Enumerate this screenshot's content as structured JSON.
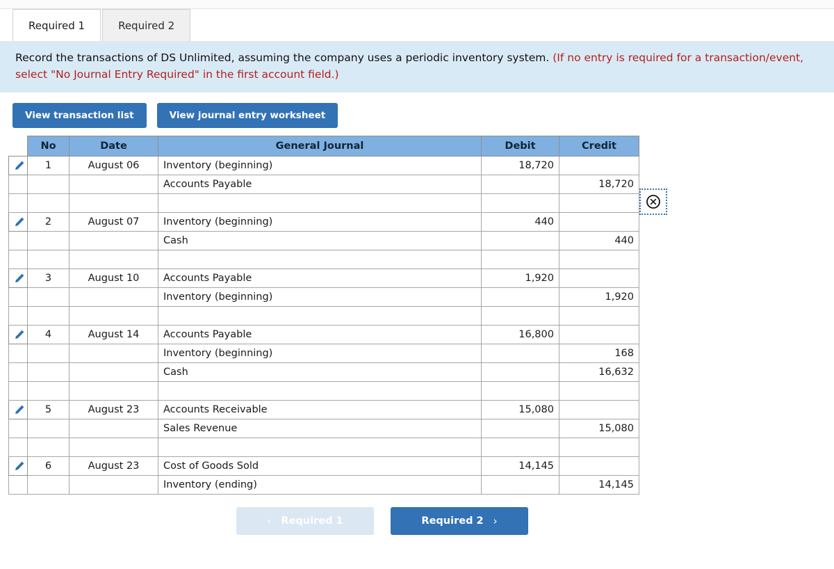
{
  "tabs": [
    {
      "label": "Required 1",
      "active": true
    },
    {
      "label": "Required 2",
      "active": false
    }
  ],
  "banner": {
    "text_black": "Record the transactions of DS Unlimited, assuming the company uses a periodic inventory system. ",
    "text_red": "(If no entry is required for a transaction/event, select \"No Journal Entry Required\" in the first account field.)"
  },
  "actions": {
    "view_transaction_list": "View transaction list",
    "view_journal_entry_worksheet": "View journal entry worksheet",
    "close_icon": "circle-x-icon"
  },
  "table": {
    "headers": {
      "no": "No",
      "date": "Date",
      "general_journal": "General Journal",
      "debit": "Debit",
      "credit": "Credit"
    },
    "rows": [
      {
        "kind": "entry",
        "pencil": "pencil-icon",
        "no": "1",
        "date": "August 06",
        "account": "Inventory (beginning)",
        "indent": false,
        "debit": "18,720",
        "credit": ""
      },
      {
        "kind": "line",
        "pencil": "",
        "no": "",
        "date": "",
        "account": "Accounts Payable",
        "indent": true,
        "debit": "",
        "credit": "18,720"
      },
      {
        "kind": "spacer",
        "pencil": "",
        "no": "",
        "date": "",
        "account": "",
        "indent": false,
        "debit": "",
        "credit": ""
      },
      {
        "kind": "entry",
        "pencil": "pencil-icon",
        "no": "2",
        "date": "August 07",
        "account": "Inventory (beginning)",
        "indent": false,
        "debit": "440",
        "credit": ""
      },
      {
        "kind": "line",
        "pencil": "",
        "no": "",
        "date": "",
        "account": "Cash",
        "indent": true,
        "debit": "",
        "credit": "440"
      },
      {
        "kind": "spacer",
        "pencil": "",
        "no": "",
        "date": "",
        "account": "",
        "indent": false,
        "debit": "",
        "credit": ""
      },
      {
        "kind": "entry",
        "pencil": "pencil-icon",
        "no": "3",
        "date": "August 10",
        "account": "Accounts Payable",
        "indent": false,
        "debit": "1,920",
        "credit": ""
      },
      {
        "kind": "line",
        "pencil": "",
        "no": "",
        "date": "",
        "account": "Inventory (beginning)",
        "indent": true,
        "debit": "",
        "credit": "1,920"
      },
      {
        "kind": "spacer",
        "pencil": "",
        "no": "",
        "date": "",
        "account": "",
        "indent": false,
        "debit": "",
        "credit": ""
      },
      {
        "kind": "entry",
        "pencil": "pencil-icon",
        "no": "4",
        "date": "August 14",
        "account": "Accounts Payable",
        "indent": false,
        "debit": "16,800",
        "credit": ""
      },
      {
        "kind": "line",
        "pencil": "",
        "no": "",
        "date": "",
        "account": "Inventory (beginning)",
        "indent": true,
        "debit": "",
        "credit": "168"
      },
      {
        "kind": "line",
        "pencil": "",
        "no": "",
        "date": "",
        "account": "Cash",
        "indent": true,
        "debit": "",
        "credit": "16,632"
      },
      {
        "kind": "spacer",
        "pencil": "",
        "no": "",
        "date": "",
        "account": "",
        "indent": false,
        "debit": "",
        "credit": ""
      },
      {
        "kind": "entry",
        "pencil": "pencil-icon",
        "no": "5",
        "date": "August 23",
        "account": "Accounts Receivable",
        "indent": false,
        "debit": "15,080",
        "credit": ""
      },
      {
        "kind": "line",
        "pencil": "",
        "no": "",
        "date": "",
        "account": "Sales Revenue",
        "indent": true,
        "debit": "",
        "credit": "15,080"
      },
      {
        "kind": "spacer",
        "pencil": "",
        "no": "",
        "date": "",
        "account": "",
        "indent": false,
        "debit": "",
        "credit": ""
      },
      {
        "kind": "entry",
        "pencil": "pencil-icon",
        "no": "6",
        "date": "August 23",
        "account": "Cost of Goods Sold",
        "indent": false,
        "debit": "14,145",
        "credit": ""
      },
      {
        "kind": "line",
        "pencil": "",
        "no": "",
        "date": "",
        "account": "Inventory (ending)",
        "indent": true,
        "debit": "",
        "credit": "14,145"
      }
    ]
  },
  "nav": {
    "prev_label": "Required 1",
    "prev_chevron": "chevron-left-icon",
    "next_label": "Required 2",
    "next_chevron": "chevron-right-icon"
  },
  "colors": {
    "accent_blue": "#3272b5",
    "table_header_blue": "#7fb0e0",
    "banner_blue": "#d9eaf7",
    "warning_red": "#b32119"
  }
}
